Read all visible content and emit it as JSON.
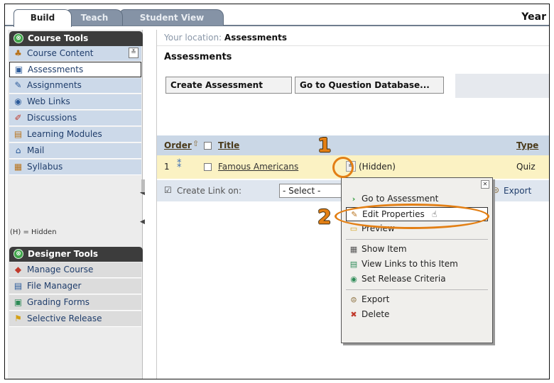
{
  "tabs": {
    "build": "Build",
    "teach": "Teach",
    "student_view": "Student View",
    "right_title": "Year"
  },
  "sidebar": {
    "course_tools_header": "Course Tools",
    "course_tools_items": [
      {
        "label": "Course Content",
        "icon": "course-content-icon"
      },
      {
        "label": "Assessments",
        "icon": "assessments-icon"
      },
      {
        "label": "Assignments",
        "icon": "assignments-icon"
      },
      {
        "label": "Web Links",
        "icon": "web-links-icon"
      },
      {
        "label": "Discussions",
        "icon": "discussions-icon"
      },
      {
        "label": "Learning Modules",
        "icon": "learning-modules-icon"
      },
      {
        "label": "Mail",
        "icon": "mail-icon"
      },
      {
        "label": "Syllabus",
        "icon": "syllabus-icon"
      }
    ],
    "hidden_note": "(H) = Hidden",
    "designer_tools_header": "Designer Tools",
    "designer_tools_items": [
      {
        "label": "Manage Course",
        "icon": "manage-course-icon"
      },
      {
        "label": "File Manager",
        "icon": "file-manager-icon"
      },
      {
        "label": "Grading Forms",
        "icon": "grading-forms-icon"
      },
      {
        "label": "Selective Release",
        "icon": "selective-release-icon"
      }
    ]
  },
  "main": {
    "location_prefix": "Your location:",
    "location_value": "Assessments",
    "page_title": "Assessments",
    "create_button": "Create Assessment",
    "goto_button": "Go to Question Database...",
    "columns": {
      "order": "Order",
      "title": "Title",
      "type": "Type"
    },
    "row": {
      "order": "1",
      "title": "Famous Americans",
      "status": "(Hidden)",
      "type": "Quiz"
    },
    "create_link_label": "Create Link on:",
    "select_value": "- Select -",
    "export_label": "Export"
  },
  "context_menu": {
    "items": [
      {
        "label": "Go to Assessment",
        "icon": "arrow-right-icon"
      },
      {
        "label": "Edit Properties",
        "icon": "pencil-icon"
      },
      {
        "label": "Preview",
        "icon": "preview-icon"
      },
      {
        "label": "Show Item",
        "icon": "show-item-icon"
      },
      {
        "label": "View Links to this Item",
        "icon": "view-links-icon"
      },
      {
        "label": "Set Release Criteria",
        "icon": "release-criteria-icon"
      },
      {
        "label": "Export",
        "icon": "export-icon"
      },
      {
        "label": "Delete",
        "icon": "delete-icon"
      }
    ]
  },
  "callouts": {
    "step1": "1",
    "step2": "2"
  },
  "colors": {
    "accent_orange": "#e37f14",
    "sidebar_blue": "#ccd9e9",
    "header_dark": "#3c3c3c",
    "row_highlight": "#fbf2c3"
  }
}
